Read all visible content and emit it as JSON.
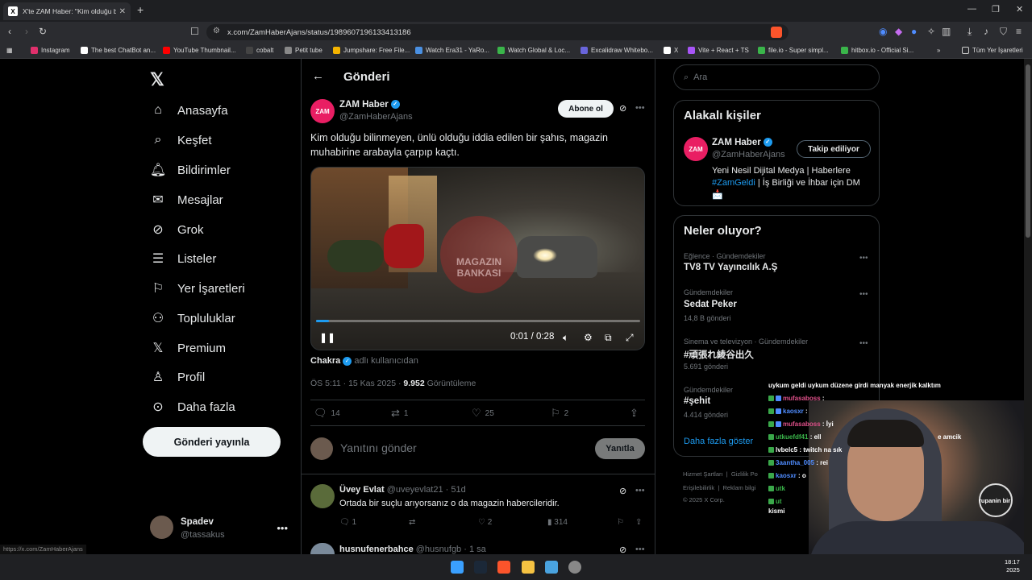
{
  "browser": {
    "tab_title": "X'te ZAM Haber: \"Kim olduğu bi",
    "tab_favicon": "X",
    "url": "x.com/ZamHaberAjans/status/1989607196133413186",
    "bookmarks": [
      {
        "label": "Instagram",
        "color": "#e1306c"
      },
      {
        "label": "The best ChatBot an...",
        "color": "#ffffff"
      },
      {
        "label": "YouTube Thumbnail...",
        "color": "#ff0000"
      },
      {
        "label": "cobalt",
        "color": "#444444"
      },
      {
        "label": "Petit tube",
        "color": "#888888"
      },
      {
        "label": "Jumpshare: Free File...",
        "color": "#f5b400"
      },
      {
        "label": "Watch Era31 - YaRo...",
        "color": "#4a90e2"
      },
      {
        "label": "Watch Global & Loc...",
        "color": "#3ab54a"
      },
      {
        "label": "Excalidraw Whitebo...",
        "color": "#6965db"
      },
      {
        "label": "X",
        "color": "#ffffff"
      },
      {
        "label": "Vite + React + TS",
        "color": "#a855f7"
      },
      {
        "label": "file.io - Super simpl...",
        "color": "#3ab54a"
      },
      {
        "label": "hitbox.io - Official Si...",
        "color": "#3ab54a"
      }
    ],
    "bookmarks_all": "Tüm Yer İşaretleri",
    "status_url": "https://x.com/ZamHaberAjans"
  },
  "nav": {
    "items": [
      {
        "label": "Anasayfa",
        "icon": "home-icon"
      },
      {
        "label": "Keşfet",
        "icon": "search-icon"
      },
      {
        "label": "Bildirimler",
        "icon": "bell-icon"
      },
      {
        "label": "Mesajlar",
        "icon": "mail-icon"
      },
      {
        "label": "Grok",
        "icon": "grok-icon"
      },
      {
        "label": "Listeler",
        "icon": "list-icon"
      },
      {
        "label": "Yer İşaretleri",
        "icon": "bookmark-icon"
      },
      {
        "label": "Topluluklar",
        "icon": "communities-icon"
      },
      {
        "label": "Premium",
        "icon": "x-premium-icon"
      },
      {
        "label": "Profil",
        "icon": "profile-icon"
      },
      {
        "label": "Daha fazla",
        "icon": "more-circle-icon"
      }
    ],
    "post_button": "Gönderi yayınla",
    "me": {
      "name": "Spadev",
      "handle": "@tassakus"
    }
  },
  "post": {
    "header": "Gönderi",
    "author_name": "ZAM Haber",
    "author_handle": "@ZamHaberAjans",
    "avatar_text": "ZAM",
    "subscribe": "Abone ol",
    "text": "Kim olduğu bilinmeyen, ünlü olduğu iddia edilen bir şahıs, magazin muhabirine arabayla çarpıp kaçtı.",
    "video": {
      "watermark_line1": "MAGAZIN",
      "watermark_line2": "BANKASI",
      "time": "0:01 / 0:28",
      "progress": 0.04
    },
    "source_user": "Chakra",
    "source_suffix": "adlı kullanıcıdan",
    "timestamp": "ÖS 5:11 · 15 Kas 2025 ·",
    "views": "9.952",
    "views_label": "Görüntüleme",
    "replies": "14",
    "reposts": "1",
    "likes": "25",
    "bookmarks": "2",
    "reply_placeholder": "Yanıtını gönder",
    "reply_button": "Yanıtla"
  },
  "comments": [
    {
      "name": "Üvey Evlat",
      "handle": "@uveyevlat21 · 51d",
      "text": "Ortada bir suçlu arıyorsanız o da magazin habercileridir.",
      "replies": "1",
      "likes": "2",
      "views": "314",
      "avatar_color": "#5a6b3a"
    },
    {
      "name": "husnufenerbahce",
      "handle": "@husnufgb · 1 sa",
      "text": "",
      "avatar_color": "#7a8a9a"
    }
  ],
  "sidebar": {
    "search_placeholder": "Ara",
    "related_title": "Alakalı kişiler",
    "related": {
      "name": "ZAM Haber",
      "handle": "@ZamHaberAjans",
      "follow": "Takip ediliyor",
      "bio_part1": "Yeni Nesil Dijital Medya | Haberlere",
      "bio_hashtag": "#ZamGeldi",
      "bio_part2": " | İş Birliği ve İhbar için DM",
      "bio_emoji": "📩"
    },
    "trends_title": "Neler oluyor?",
    "trends": [
      {
        "category": "Eğlence · Gündemdekiler",
        "title": "TV8 TV Yayıncılık A.Ş",
        "count": ""
      },
      {
        "category": "Gündemdekiler",
        "title": "Sedat Peker",
        "count": "14,8 B gönderi"
      },
      {
        "category": "Sinema ve televizyon · Gündemdekiler",
        "title": "#頑張れ綾谷出久",
        "count": "5.691 gönderi"
      },
      {
        "category": "Gündemdekiler",
        "title": "#şehit",
        "count": "4.414 gönderi"
      }
    ],
    "show_more": "Daha fazla göster",
    "footer": {
      "line1a": "Hizmet Şartları",
      "line1b": "Gizlilik Po",
      "line2a": "Erişilebilirlik",
      "line2b": "Reklam bilgi",
      "line3": "© 2025 X Corp."
    }
  },
  "stream_chat": {
    "header": "uykum geldi uykum düzene girdi manyak enerjik kalktım",
    "lines": [
      {
        "user": "mufasaboss",
        "msg": ":",
        "color": "#e0508a"
      },
      {
        "user": "kaosxr",
        "msg": ":",
        "color": "#4f8cff"
      },
      {
        "user": "mufasaboss",
        "msg": ": İyi",
        "color": "#e0508a"
      },
      {
        "user": "utkuefdf41",
        "msg": ": ell",
        "color": "#3ab54a"
      },
      {
        "user": "lvbelc5",
        "msg": ": twitch na sık",
        "color": "#ffffff"
      },
      {
        "user": "3aantha_005",
        "msg": ": rei",
        "color": "#4f8cff"
      },
      {
        "user": "kaosxr",
        "msg": ": o",
        "color": "#4f8cff"
      },
      {
        "user": "utk",
        "msg": "",
        "color": "#3ab54a"
      },
      {
        "user": "ut",
        "msg": "",
        "color": "#3ab54a"
      }
    ],
    "extra1": "e amcik",
    "extra2": "kismi",
    "cam_label": "rupanin bir"
  },
  "taskbar": {
    "time": "18:17",
    "year": "2025"
  }
}
